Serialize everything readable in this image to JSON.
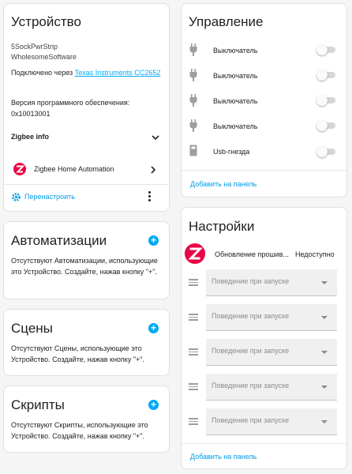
{
  "device": {
    "title": "Устройство",
    "model": "5SockPwrStrip",
    "manufacturer": "WholesomeSoftware",
    "connected_prefix": "Подключено через ",
    "connected_link": "Texas Instruments CC2652",
    "firmware_label": "Версия программного обеспечения:",
    "firmware_value": "0x10013001",
    "zigbee_info": "Zigbee info",
    "integration": "Zigbee Home Automation",
    "reconfigure": "Перенастроить"
  },
  "automations": {
    "title": "Автоматизации",
    "empty": "Отсутствуют Автоматизации, использующие это Устройство. Создайте, нажав кнопку \"+\"."
  },
  "scenes": {
    "title": "Сцены",
    "empty": "Отсутствуют Сцены, использующие это Устройство. Создайте, нажав кнопку \"+\"."
  },
  "scripts": {
    "title": "Скрипты",
    "empty": "Отсутствуют Скрипты, использующие это Устройство. Создайте, нажав кнопку \"+\"."
  },
  "controls": {
    "title": "Управление",
    "items": [
      {
        "label": "Выключатель",
        "icon": "power-plug-icon",
        "on": false
      },
      {
        "label": "Выключатель",
        "icon": "power-plug-icon",
        "on": false
      },
      {
        "label": "Выключатель",
        "icon": "power-plug-icon",
        "on": false
      },
      {
        "label": "Выключатель",
        "icon": "power-plug-icon",
        "on": false
      },
      {
        "label": "Usb-гнезда",
        "icon": "usb-socket-icon",
        "on": false
      }
    ],
    "add_to_panel": "Добавить на панель"
  },
  "settings": {
    "title": "Настройки",
    "firmware_update_label": "Обновление прошив...",
    "firmware_update_status": "Недоступно",
    "selects": [
      {
        "placeholder": "Поведение при запуске"
      },
      {
        "placeholder": "Поведение при запуске"
      },
      {
        "placeholder": "Поведение при запуске"
      },
      {
        "placeholder": "Поведение при запуске"
      },
      {
        "placeholder": "Поведение при запуске"
      }
    ],
    "add_to_panel": "Добавить на панель"
  },
  "colors": {
    "accent": "#03a9f4",
    "zigbee": "#eb0443"
  }
}
